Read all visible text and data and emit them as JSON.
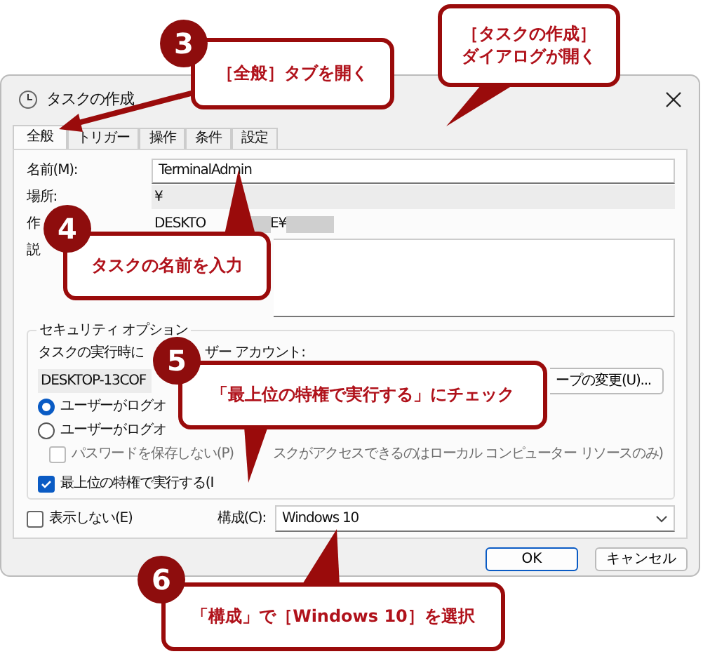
{
  "window": {
    "title": "タスクの作成"
  },
  "tabs": [
    {
      "label": "全般",
      "selected": true
    },
    {
      "label": "トリガー",
      "selected": false
    },
    {
      "label": "操作",
      "selected": false
    },
    {
      "label": "条件",
      "selected": false
    },
    {
      "label": "設定",
      "selected": false
    }
  ],
  "fields": [
    {
      "kind": "input",
      "label": "名前(M):",
      "value": "TerminalAdmin"
    },
    {
      "kind": "readonly",
      "label": "場所:",
      "value": "¥"
    },
    {
      "kind": "author",
      "label": "作",
      "value": "DESKTO",
      "value_2": "E¥"
    },
    {
      "kind": "textarea",
      "label": "説"
    }
  ],
  "security": {
    "title": "セキュリティ オプション",
    "account_label": "タスクの実行時に",
    "account_label_2": "ザー アカウント:",
    "account": "DESKTOP-13COF",
    "change_button": "ープの変更(U)...",
    "options": [
      {
        "kind": "radio",
        "label": "ユーザーがログオ",
        "selected": true,
        "disabled": false
      },
      {
        "kind": "radio",
        "label": "ユーザーがログオ",
        "selected": false,
        "disabled": false
      },
      {
        "kind": "checkbox",
        "label": "パスワードを保存しない(P)",
        "label_2": "スクがアクセスできるのはローカル コンピューター リソースのみ)",
        "checked": false,
        "disabled": true
      },
      {
        "kind": "checkbox",
        "label": "最上位の特権で実行する(I",
        "checked": true,
        "disabled": false
      }
    ]
  },
  "hidden": {
    "label": "表示しない(E)",
    "checked": false
  },
  "configure": {
    "label": "構成(C):",
    "value": "Windows 10"
  },
  "buttons": [
    {
      "label": "OK",
      "default": true
    },
    {
      "label": "キャンセル",
      "default": false
    }
  ],
  "callouts": [
    {
      "number": "3",
      "lines": [
        "［全般］タブを開く"
      ]
    },
    {
      "lines": [
        "［タスクの作成］",
        "ダイアログが開く"
      ]
    },
    {
      "number": "4",
      "lines": [
        "タスクの名前を入力"
      ]
    },
    {
      "number": "5",
      "lines": [
        "「最上位の特権で実行する」にチェック"
      ]
    },
    {
      "number": "6",
      "lines": [
        "「構成」で［Windows 10］を選択"
      ]
    }
  ]
}
